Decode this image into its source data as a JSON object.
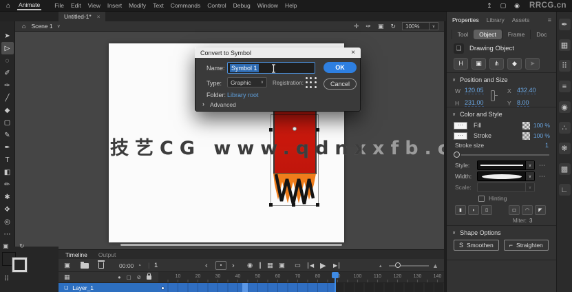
{
  "menubar": {
    "home_icon": "⌂",
    "app": "Animate",
    "items": [
      "File",
      "Edit",
      "View",
      "Insert",
      "Modify",
      "Text",
      "Commands",
      "Control",
      "Debug",
      "Window",
      "Help"
    ],
    "share_icon": "↥",
    "maximize_icon": "▢",
    "record_icon": "◉",
    "brand": "RRCG.cn"
  },
  "doc_tab": {
    "label": "Untitled-1*",
    "close_icon": "×"
  },
  "edit_bar": {
    "home_icon": "⌂",
    "scene": "Scene 1",
    "caret_icon": "∨",
    "icons": [
      {
        "name": "center-frame-icon",
        "glyph": "✛"
      },
      {
        "name": "draw-outlines-icon",
        "glyph": "✑"
      },
      {
        "name": "clip-content-icon",
        "glyph": "▣"
      },
      {
        "name": "rotation-icon",
        "glyph": "↻"
      }
    ],
    "zoom_value": "100%"
  },
  "toolbar": {
    "tools": [
      {
        "name": "selection-tool",
        "glyph": "➤"
      },
      {
        "name": "subselection-tool",
        "glyph": "▷",
        "active": true
      },
      {
        "name": "lasso-tool",
        "glyph": "◌"
      },
      {
        "name": "fluid-brush-tool",
        "glyph": "✐"
      },
      {
        "name": "classic-brush-tool",
        "glyph": "✑"
      },
      {
        "name": "line-tool",
        "glyph": "╱"
      },
      {
        "name": "eraser-tool",
        "glyph": "◆"
      },
      {
        "name": "rectangle-tool",
        "glyph": "▢"
      },
      {
        "name": "pencil-tool",
        "glyph": "✎"
      },
      {
        "name": "pen-tool",
        "glyph": "✒"
      },
      {
        "name": "text-tool",
        "glyph": "T"
      },
      {
        "name": "paint-bucket-tool",
        "glyph": "◧"
      },
      {
        "name": "ink-bottle-tool",
        "glyph": "✏"
      },
      {
        "name": "asset-warp-tool",
        "glyph": "✱"
      },
      {
        "name": "hand-tool",
        "glyph": "✥"
      },
      {
        "name": "zoom-tool",
        "glyph": "◎"
      },
      {
        "name": "more-tools",
        "glyph": "⋯"
      }
    ],
    "snapshot_icon": "▣",
    "rotate_icon": "↻",
    "fill_color": "#f07c1e",
    "grid_icon": "⠿"
  },
  "stage": {
    "watermark": "技艺CG  www.qdnxxfb.c"
  },
  "dialog": {
    "title": "Convert to Symbol",
    "close_icon": "×",
    "name_label": "Name:",
    "name_value": "Symbol 1",
    "ok_label": "OK",
    "type_label": "Type:",
    "type_value": "Graphic",
    "type_caret": "∨",
    "registration_label": "Registration:",
    "cancel_label": "Cancel",
    "folder_label": "Folder:",
    "folder_value": "Library root",
    "advanced_icon": "›",
    "advanced_label": "Advanced"
  },
  "properties": {
    "tabs": [
      {
        "label": "Properties",
        "active": true
      },
      {
        "label": "Library"
      },
      {
        "label": "Assets"
      }
    ],
    "menu_icon": "≡",
    "subtabs": [
      {
        "label": "Tool"
      },
      {
        "label": "Object",
        "active": true
      },
      {
        "label": "Frame"
      },
      {
        "label": "Doc"
      }
    ],
    "object_icon": "❏",
    "object_type": "Drawing Object",
    "actions": [
      {
        "name": "flip-horizontal-button",
        "glyph": "H"
      },
      {
        "name": "expand-to-fill-button",
        "glyph": "▣"
      },
      {
        "name": "break-apart-button",
        "glyph": "⋔"
      },
      {
        "name": "union-button",
        "glyph": "◆"
      },
      {
        "name": "edit-object-button",
        "glyph": "➤",
        "dim": true
      }
    ],
    "position": {
      "title": "Position and Size",
      "chevron": "∨",
      "w_label": "W",
      "w_value": "120.05",
      "h_label": "H",
      "h_value": "231.00",
      "x_label": "X",
      "x_value": "432.40",
      "y_label": "Y",
      "y_value": "8.00"
    },
    "color": {
      "title": "Color and Style",
      "chevron": "∨",
      "fill_label": "Fill",
      "fill_swatch": "···",
      "fill_opacity": "100 %",
      "stroke_label": "Stroke",
      "stroke_swatch": "···",
      "stroke_opacity": "100 %",
      "stroke_size_label": "Stroke size",
      "stroke_size_value": "1",
      "style_label": "Style:",
      "width_label": "Width:",
      "scale_label": "Scale:",
      "caret_icon": "∨",
      "more_icon": "⋯",
      "hinting_label": "Hinting",
      "caps": [
        {
          "name": "cap-flat-button",
          "glyph": "▮"
        },
        {
          "name": "cap-round-button",
          "glyph": "◗"
        },
        {
          "name": "cap-square-button",
          "glyph": "▯"
        }
      ],
      "joins": [
        {
          "name": "join-miter-button",
          "glyph": "◻"
        },
        {
          "name": "join-round-button",
          "glyph": "◠"
        },
        {
          "name": "join-bevel-button",
          "glyph": "◤"
        }
      ],
      "miter_label": "Miter:",
      "miter_value": "3"
    },
    "shape": {
      "title": "Shape Options",
      "chevron": "∨",
      "buttons": [
        {
          "name": "smoothen-button",
          "icon": "S",
          "label": "Smoothen"
        },
        {
          "name": "straighten-button",
          "icon": "⌐",
          "label": "Straighten"
        }
      ]
    }
  },
  "right_rail": {
    "icons": [
      {
        "name": "brush-library-panel-icon",
        "glyph": "✒"
      },
      {
        "name": "swatches-panel-icon",
        "glyph": "▦"
      },
      {
        "name": "align-panel-icon",
        "glyph": "⠿"
      },
      {
        "name": "layers-panel-icon",
        "glyph": "≡"
      },
      {
        "name": "history-panel-icon",
        "glyph": "◉"
      },
      {
        "name": "particles-panel-icon",
        "glyph": "∴"
      },
      {
        "name": "asset-warp-panel-icon",
        "glyph": "❋"
      },
      {
        "name": "fragments-panel-icon",
        "glyph": "▩"
      },
      {
        "name": "motion-editor-panel-icon",
        "glyph": "∟"
      }
    ]
  },
  "timeline": {
    "tabs": [
      {
        "label": "Timeline",
        "active": true
      },
      {
        "label": "Output"
      }
    ],
    "insert_frame_icon": "▣",
    "time_value": "00:00",
    "clock_icon": "◔",
    "frame_value": "1",
    "prev_icon": "‹",
    "marker_icon": "▪",
    "next_icon": "›",
    "onion_icons": [
      {
        "name": "onion-skin-icon",
        "glyph": "◉"
      },
      {
        "name": "onion-outlines-icon",
        "glyph": "∥"
      },
      {
        "name": "edit-multiple-frames-icon",
        "glyph": "▦"
      },
      {
        "name": "camera-icon",
        "glyph": "▣"
      }
    ],
    "loop_icon": "▭",
    "step_back_icon": "◀",
    "play_icon": "▶",
    "step_fwd_icon": "▶",
    "zoom_out_icon": "▴",
    "zoom_in_icon": "▲",
    "layer_camera_icon": "▦",
    "eye_icon": "●",
    "outline_icon": "▢",
    "hide_icon": "⊘",
    "layer_icon": "❏",
    "layer_name": "Layer_1",
    "ruler_numbers": [
      10,
      20,
      30,
      40,
      50,
      60,
      70,
      80,
      90,
      100,
      110,
      120,
      130,
      140
    ]
  }
}
